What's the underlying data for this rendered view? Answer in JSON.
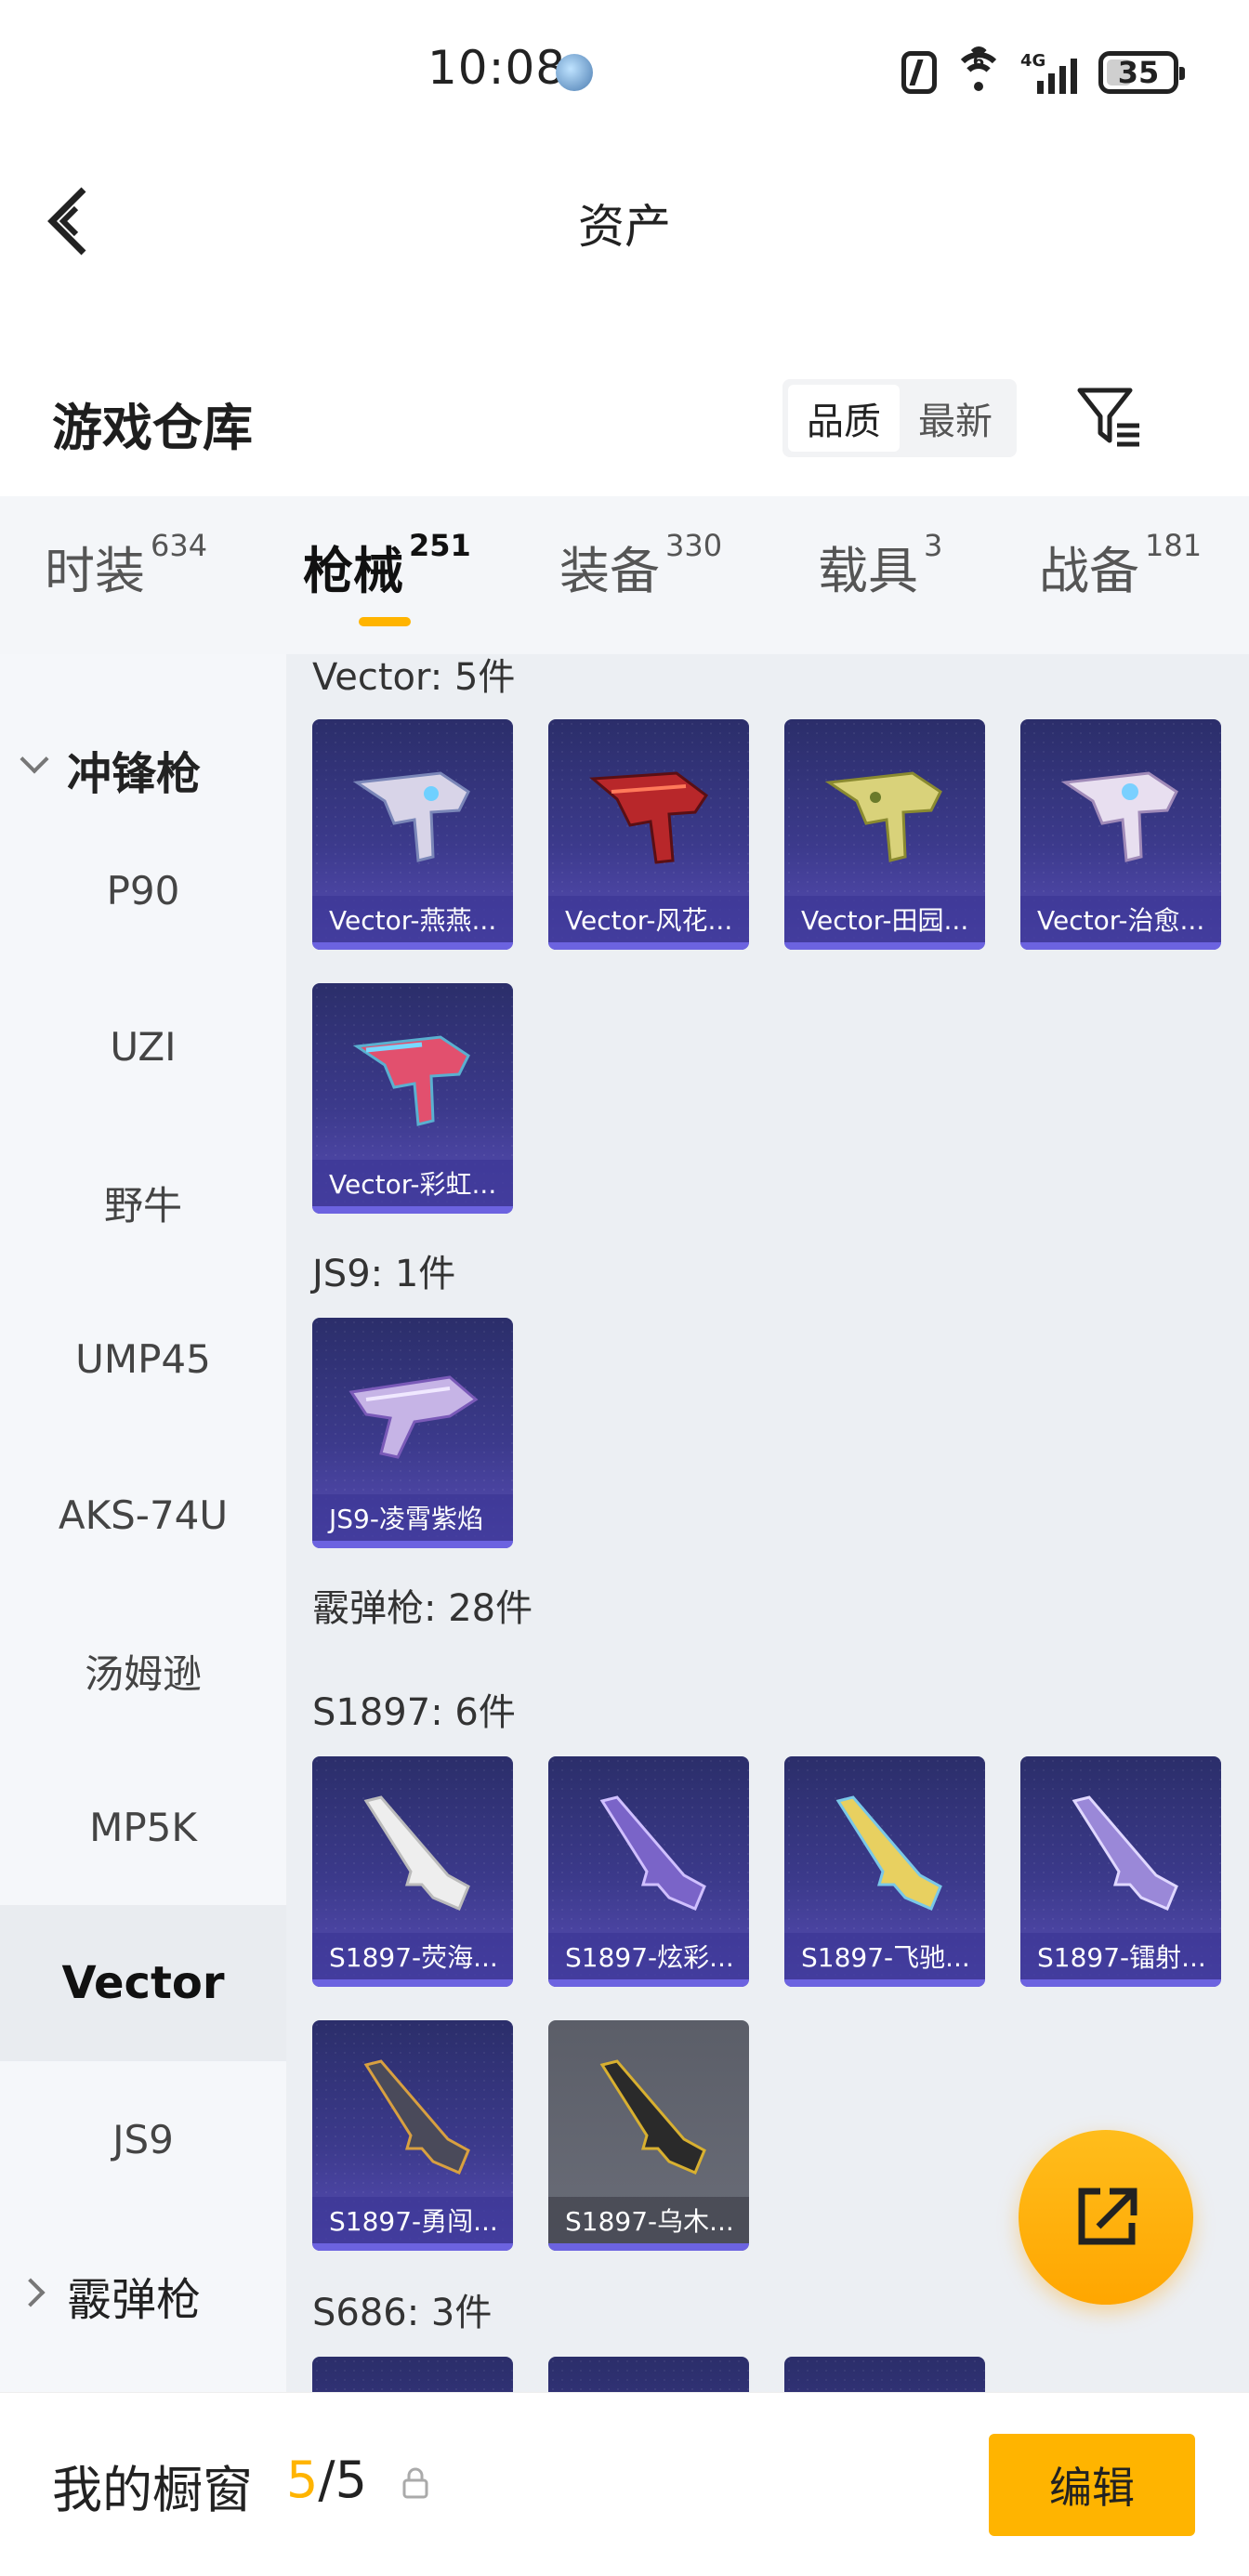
{
  "status_bar": {
    "time": "10:08",
    "battery": "35",
    "network_badge": "4G",
    "wifi_badge": "6"
  },
  "header": {
    "title": "资产",
    "back_icon": "back-arrow-icon"
  },
  "warehouse": {
    "title": "游戏仓库",
    "sort_options": [
      "品质",
      "最新"
    ],
    "active_sort": "品质",
    "filter_icon": "filter-icon"
  },
  "tabs": [
    {
      "label": "时装",
      "count": "634"
    },
    {
      "label": "枪械",
      "count": "251",
      "active": true
    },
    {
      "label": "装备",
      "count": "330"
    },
    {
      "label": "载具",
      "count": "3"
    },
    {
      "label": "战备",
      "count": "181"
    }
  ],
  "sidebar": {
    "groups": [
      {
        "label": "冲锋枪",
        "expanded": true
      },
      {
        "label": "霰弹枪",
        "expanded": false
      }
    ],
    "items": [
      "P90",
      "UZI",
      "野牛",
      "UMP45",
      "AKS-74U",
      "汤姆逊",
      "MP5K",
      "Vector",
      "JS9"
    ],
    "active": "Vector"
  },
  "content": {
    "groups": [
      {
        "label": "Vector: 5件",
        "items": [
          "Vector-燕燕...",
          "Vector-风花...",
          "Vector-田园...",
          "Vector-治愈...",
          "Vector-彩虹..."
        ]
      },
      {
        "label": "JS9: 1件",
        "items": [
          "JS9-凌霄紫焰"
        ]
      },
      {
        "label": "霰弹枪: 28件",
        "items": []
      },
      {
        "label": "S1897: 6件",
        "items": [
          "S1897-荧海...",
          "S1897-炫彩...",
          "S1897-飞驰...",
          "S1897-镭射...",
          "S1897-勇闯...",
          "S1897-乌木..."
        ]
      },
      {
        "label": "S686: 3件",
        "items": []
      }
    ]
  },
  "fab": {
    "icon": "share-external-icon"
  },
  "bottom_bar": {
    "title": "我的橱窗",
    "used": "5",
    "separator": "/",
    "total": "5",
    "edit_label": "编辑",
    "lock_icon": "lock-icon"
  },
  "colors": {
    "accent": "#ffb400",
    "card_purple": "#3c3a8c",
    "sidebar_bg": "#f5f7fa",
    "content_bg": "#eceff3"
  }
}
